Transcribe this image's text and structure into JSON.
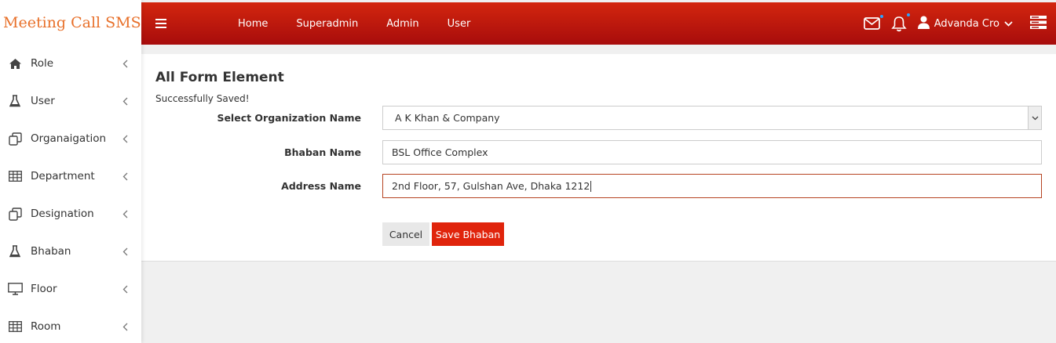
{
  "brand": "Meeting Call SMS",
  "sidebar": {
    "items": [
      {
        "label": "Role",
        "icon": "home-icon"
      },
      {
        "label": "User",
        "icon": "flask-icon"
      },
      {
        "label": "Organaigation",
        "icon": "clone-icon"
      },
      {
        "label": "Department",
        "icon": "table-icon"
      },
      {
        "label": "Designation",
        "icon": "clone-icon"
      },
      {
        "label": "Bhaban",
        "icon": "flask-icon"
      },
      {
        "label": "Floor",
        "icon": "monitor-icon"
      },
      {
        "label": "Room",
        "icon": "table-icon"
      }
    ]
  },
  "topbar": {
    "nav": [
      "Home",
      "Superadmin",
      "Admin",
      "User"
    ],
    "user_name": "Advanda Cro",
    "colors": {
      "gradient_top": "#d3260e",
      "gradient_bottom": "#a70c0c",
      "badge": "#2aa3ff"
    }
  },
  "form": {
    "title": "All Form Element",
    "status": "Successfully Saved!",
    "org_label": "Select Organization Name",
    "org_value": "A K Khan & Company",
    "bhaban_label": "Bhaban Name",
    "bhaban_value": "BSL Office Complex",
    "address_label": "Address Name",
    "address_value": "2nd Floor, 57, Gulshan Ave, Dhaka 1212",
    "cancel_label": "Cancel",
    "save_label": "Save Bhaban"
  }
}
